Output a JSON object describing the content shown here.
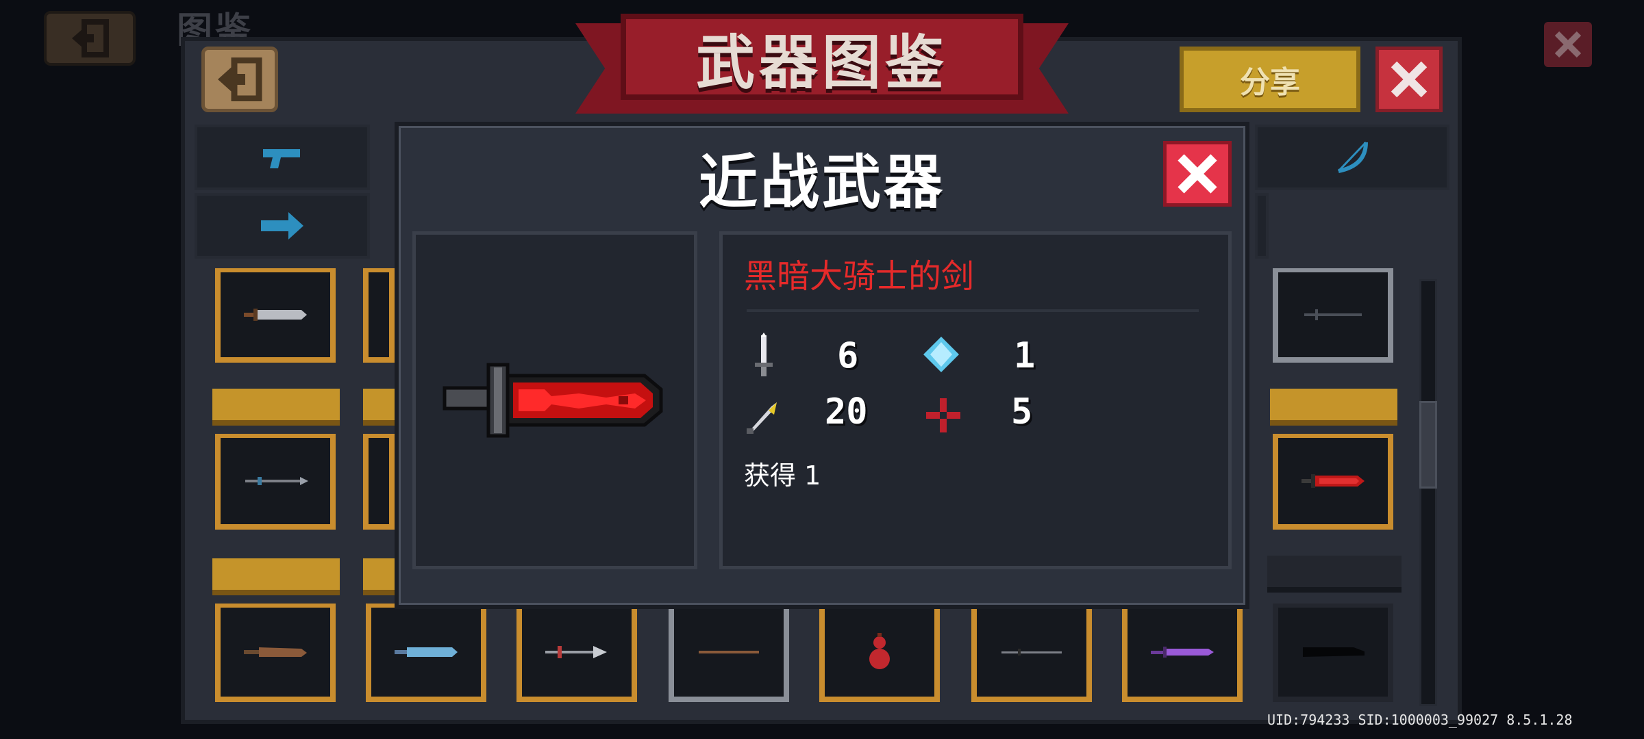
{
  "background": {
    "title": "图鉴"
  },
  "header": {
    "title": "武器图鉴",
    "share_label": "分享"
  },
  "categories": [
    {
      "icon": "pistol-icon"
    },
    {
      "icon": "bow-icon"
    },
    {
      "icon": "arrow-launcher-icon"
    }
  ],
  "grid_slots": [
    {
      "icon": "short-sword-icon",
      "frame": "gold"
    },
    {
      "icon": "dim-sword-icon",
      "frame": "silver"
    },
    {
      "icon": "spear-icon",
      "frame": "gold"
    },
    {
      "icon": "red-sword-icon",
      "frame": "gold"
    },
    {
      "icon": "knife-icon",
      "frame": "gold"
    },
    {
      "icon": "blue-blade-icon",
      "frame": "gold"
    },
    {
      "icon": "trident-icon",
      "frame": "gold"
    },
    {
      "icon": "staff-icon",
      "frame": "silver"
    },
    {
      "icon": "gourd-icon",
      "frame": "gold"
    },
    {
      "icon": "thin-rapier-icon",
      "frame": "gold"
    },
    {
      "icon": "purple-sword-icon",
      "frame": "gold"
    },
    {
      "icon": "unknown-weapon-icon",
      "frame": "dark"
    }
  ],
  "dialog": {
    "title": "近战武器",
    "weapon_name": "黑暗大骑士的剑",
    "stats": {
      "damage": "6",
      "energy": "1",
      "critical": "20",
      "accuracy": "5"
    },
    "acquired": "获得 1"
  },
  "footer": {
    "info": "UID:794233 SID:1000003_99027 8.5.1.28"
  },
  "colors": {
    "weapon_name": "#e62a2a",
    "banner": "#981e2a",
    "share": "#c79f2b",
    "close": "#e5344a"
  }
}
